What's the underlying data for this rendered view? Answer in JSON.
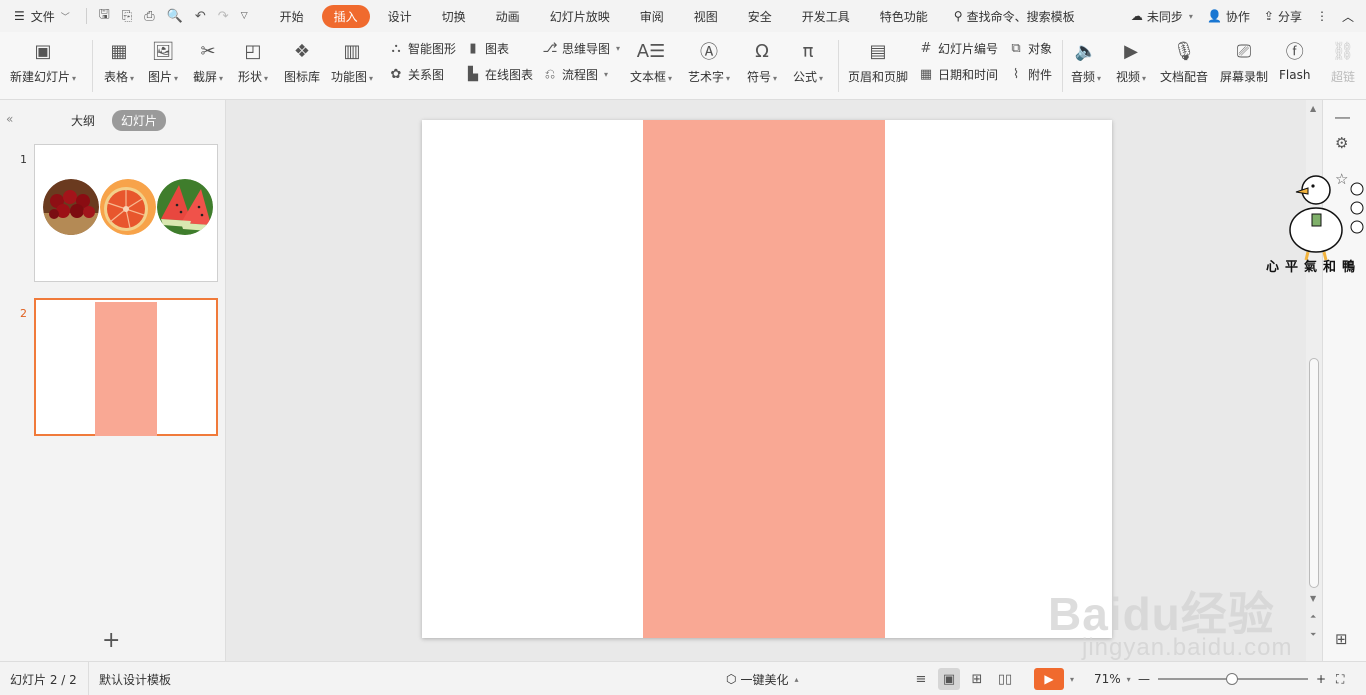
{
  "menubar": {
    "file_label": "文件",
    "tabs": [
      {
        "label": "开始",
        "active": false
      },
      {
        "label": "插入",
        "active": true
      },
      {
        "label": "设计",
        "active": false
      },
      {
        "label": "切换",
        "active": false
      },
      {
        "label": "动画",
        "active": false
      },
      {
        "label": "幻灯片放映",
        "active": false
      },
      {
        "label": "审阅",
        "active": false
      },
      {
        "label": "视图",
        "active": false
      },
      {
        "label": "安全",
        "active": false
      },
      {
        "label": "开发工具",
        "active": false
      },
      {
        "label": "特色功能",
        "active": false
      }
    ],
    "search_label": "查找命令、搜索模板",
    "sync_label": "未同步",
    "collab_label": "协作",
    "share_label": "分享"
  },
  "ribbon": {
    "new_slide": "新建幻灯片",
    "table": "表格",
    "picture": "图片",
    "screenshot": "截屏",
    "shape": "形状",
    "icon_lib": "图标库",
    "function_chart": "功能图",
    "smart_graphic": "智能图形",
    "chart": "图表",
    "relation": "关系图",
    "online_chart": "在线图表",
    "mindmap": "思维导图",
    "flowchart": "流程图",
    "textbox": "文本框",
    "wordart": "艺术字",
    "symbol": "符号",
    "formula": "公式",
    "header_footer": "页眉和页脚",
    "slide_number": "幻灯片编号",
    "object": "对象",
    "datetime": "日期和时间",
    "attachment": "附件",
    "audio": "音频",
    "video": "视频",
    "doc_dub": "文档配音",
    "screen_record": "屏幕录制",
    "flash": "Flash",
    "hyperlink": "超链"
  },
  "leftpanel": {
    "outline_tab": "大纲",
    "slides_tab": "幻灯片",
    "slides": [
      {
        "number": "1",
        "selected": false
      },
      {
        "number": "2",
        "selected": true
      }
    ]
  },
  "slide": {
    "rect_color": "#f9a894"
  },
  "watermark": {
    "duck_text": "心平氣和鴨",
    "baidu_logo": "Baidu经验",
    "baidu_url": "jingyan.baidu.com"
  },
  "statusbar": {
    "slide_counter": "幻灯片 2 / 2",
    "template": "默认设计模板",
    "beautify": "一键美化",
    "zoom": "71%",
    "zoom_fraction": 0.49
  },
  "colors": {
    "accent": "#f06a2e",
    "rect": "#f9a894"
  }
}
